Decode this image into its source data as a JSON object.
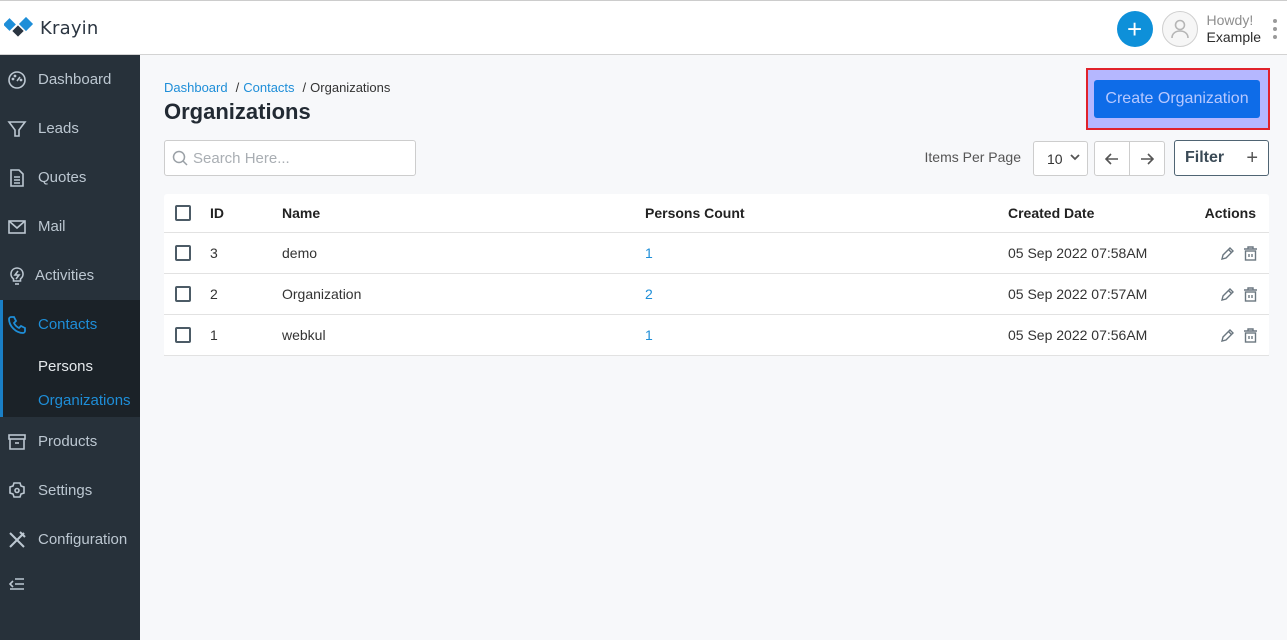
{
  "app": {
    "name": "Krayin"
  },
  "header": {
    "greeting": "Howdy!",
    "user_name": "Example",
    "quick_add_icon": "plus-icon",
    "avatar_icon": "user-icon",
    "menu_icon": "kebab-menu-icon"
  },
  "sidebar": {
    "items": [
      {
        "label": "Dashboard",
        "icon": "dashboard-gauge-icon"
      },
      {
        "label": "Leads",
        "icon": "funnel-icon"
      },
      {
        "label": "Quotes",
        "icon": "document-icon"
      },
      {
        "label": "Mail",
        "icon": "envelope-icon"
      },
      {
        "label": "Activities",
        "icon": "lightbulb-icon"
      },
      {
        "label": "Contacts",
        "icon": "phone-icon",
        "active": true,
        "children": [
          {
            "label": "Persons"
          },
          {
            "label": "Organizations",
            "active": true
          }
        ]
      },
      {
        "label": "Products",
        "icon": "archive-box-icon"
      },
      {
        "label": "Settings",
        "icon": "gear-icon"
      },
      {
        "label": "Configuration",
        "icon": "tools-icon"
      }
    ],
    "collapse_icon": "collapse-menu-icon"
  },
  "breadcrumb": [
    {
      "label": "Dashboard"
    },
    {
      "label": "Contacts"
    },
    {
      "label": "Organizations"
    }
  ],
  "page": {
    "title": "Organizations",
    "create_button": "Create Organization"
  },
  "toolbar": {
    "search_placeholder": "Search Here...",
    "search_value": "",
    "items_per_page_label": "Items Per Page",
    "items_per_page_value": "10",
    "filter_label": "Filter",
    "filter_icon": "+"
  },
  "table": {
    "columns": [
      "ID",
      "Name",
      "Persons Count",
      "Created Date",
      "Actions"
    ],
    "rows": [
      {
        "id": "3",
        "name": "demo",
        "persons_count": "1",
        "created": "05 Sep 2022 07:58AM"
      },
      {
        "id": "2",
        "name": "Organization",
        "persons_count": "2",
        "created": "05 Sep 2022 07:57AM"
      },
      {
        "id": "1",
        "name": "webkul",
        "persons_count": "1",
        "created": "05 Sep 2022 07:56AM"
      }
    ]
  },
  "colors": {
    "accent": "#0e90d9",
    "link": "#1e8ed8",
    "primary_button": "#0e6ce8",
    "sidebar_bg": "#27313a",
    "highlight_border": "#e0222b"
  }
}
